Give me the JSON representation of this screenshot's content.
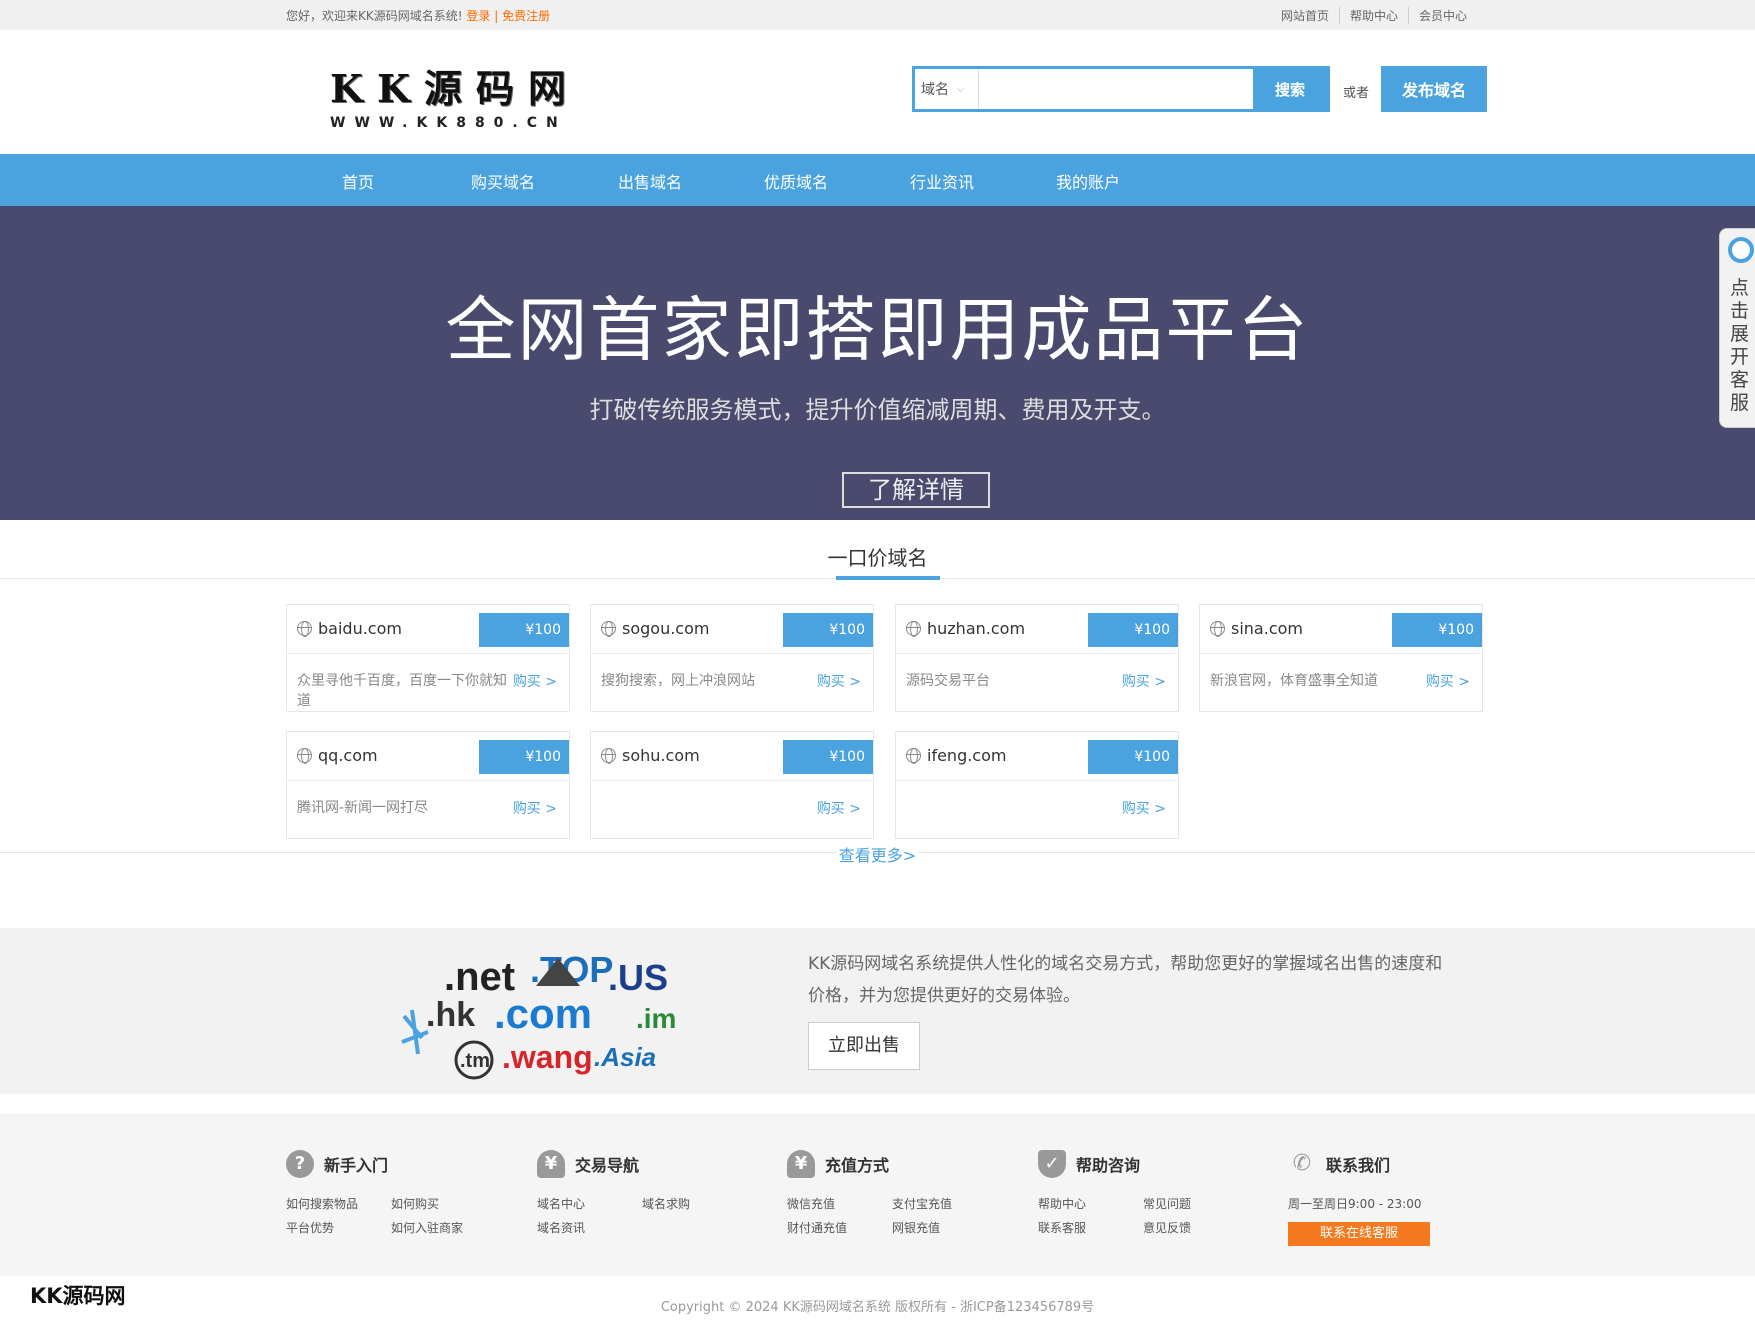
{
  "topbar": {
    "welcome": "您好，欢迎来KK源码网域名系统!",
    "login": "登录",
    "sep": "|",
    "register": "免费注册",
    "links": [
      "网站首页",
      "帮助中心",
      "会员中心"
    ]
  },
  "logo": {
    "main": "KK源码网",
    "sub": "WWW.KK880.CN"
  },
  "search": {
    "type": "域名",
    "placeholder": "",
    "button": "搜索",
    "or": "或者",
    "publish": "发布域名"
  },
  "nav": [
    "首页",
    "购买域名",
    "出售域名",
    "优质域名",
    "行业资讯",
    "我的账户"
  ],
  "banner": {
    "title": "全网首家即搭即用成品平台",
    "subtitle": "打破传统服务模式，提升价值缩减周期、费用及开支。",
    "button": "了解详情"
  },
  "kefu": {
    "text": "点击展开客服"
  },
  "section": {
    "title": "一口价域名",
    "more": "查看更多>"
  },
  "domains": [
    {
      "name": "baidu.com",
      "price": "¥100",
      "desc": "众里寻他千百度，百度一下你就知道",
      "buy": "购买 >"
    },
    {
      "name": "sogou.com",
      "price": "¥100",
      "desc": "搜狗搜索，网上冲浪网站",
      "buy": "购买 >"
    },
    {
      "name": "huzhan.com",
      "price": "¥100",
      "desc": "源码交易平台",
      "buy": "购买 >"
    },
    {
      "name": "sina.com",
      "price": "¥100",
      "desc": "新浪官网，体育盛事全知道",
      "buy": "购买 >"
    },
    {
      "name": "qq.com",
      "price": "¥100",
      "desc": "腾讯网-新闻一网打尽",
      "buy": "购买 >"
    },
    {
      "name": "sohu.com",
      "price": "¥100",
      "desc": "",
      "buy": "购买 >"
    },
    {
      "name": "ifeng.com",
      "price": "¥100",
      "desc": "",
      "buy": "购买 >"
    }
  ],
  "promo": {
    "text": "KK源码网域名系统提供人性化的域名交易方式，帮助您更好的掌握域名出售的速度和价格，并为您提供更好的交易体验。",
    "button": "立即出售",
    "logos": [
      ".net",
      ".TOP",
      ".US",
      ".hk",
      ".com",
      ".im",
      ".tm",
      ".wang",
      ".Asia"
    ]
  },
  "footer": [
    {
      "title": "新手入门",
      "icon": "question-icon",
      "links": [
        "如何搜索物品",
        "如何购买",
        "平台优势",
        "如何入驻商家"
      ]
    },
    {
      "title": "交易导航",
      "icon": "user-icon",
      "links": [
        "域名中心",
        "域名求购",
        "域名资讯"
      ]
    },
    {
      "title": "充值方式",
      "icon": "user-wallet-icon",
      "links": [
        "微信充值",
        "支付宝充值",
        "财付通充值",
        "网银充值"
      ]
    },
    {
      "title": "帮助咨询",
      "icon": "shield-icon",
      "links": [
        "帮助中心",
        "常见问题",
        "联系客服",
        "意见反馈"
      ]
    },
    {
      "title": "联系我们",
      "icon": "phone-icon",
      "links": [
        "周一至周日9:00 - 23:00"
      ],
      "button": "联系在线客服"
    }
  ],
  "copyright": "Copyright © 2024 KK源码网域名系统 版权所有 - 浙ICP备123456789号",
  "watermark": "KK源码网",
  "colors": {
    "accent": "#4aa3df",
    "banner": "#4a4a6e",
    "orange": "#f57a1f"
  }
}
